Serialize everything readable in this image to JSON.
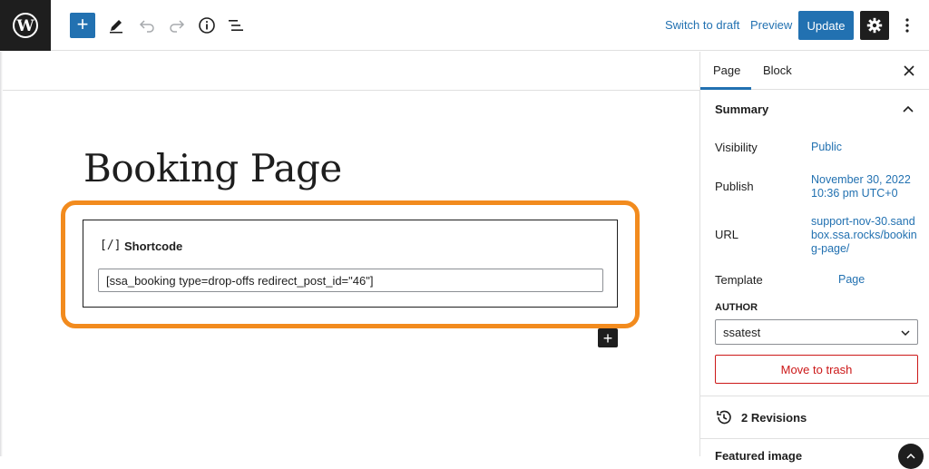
{
  "toolbar": {
    "logo_icon": "wordpress-logo-icon",
    "add_label": "+",
    "switch_to_draft": "Switch to draft",
    "preview": "Preview",
    "update": "Update",
    "accent_color": "#2271b1"
  },
  "editor": {
    "title": "Booking Page",
    "block": {
      "icon_text": "[/]",
      "label": "Shortcode",
      "value": "[ssa_booking type=drop-offs redirect_post_id=\"46\"]"
    },
    "highlight_color": "#f28b1e",
    "inserter_label": "+"
  },
  "sidebar": {
    "tabs": [
      "Page",
      "Block"
    ],
    "active_tab": "Page",
    "summary": {
      "heading": "Summary",
      "visibility_label": "Visibility",
      "visibility_value": "Public",
      "publish_label": "Publish",
      "publish_date": "November 30, 2022",
      "publish_time": "10:36 pm UTC+0",
      "url_label": "URL",
      "url_value": "support-nov-30.sandbox.ssa.rocks/booking-page/",
      "template_label": "Template",
      "template_value": "Page",
      "author_label": "AUTHOR",
      "author_value": "ssatest",
      "trash_label": "Move to trash",
      "trash_color": "#cc1818"
    },
    "revisions": "2 Revisions",
    "featured_image": "Featured image"
  }
}
